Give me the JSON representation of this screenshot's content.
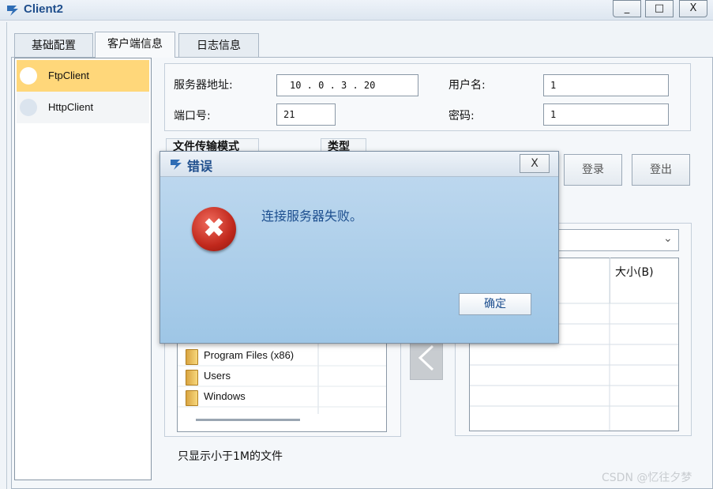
{
  "window": {
    "title": "Client2",
    "controls": {
      "minimize": "_",
      "maximize": "□",
      "close": "X"
    }
  },
  "tabs": [
    {
      "label": "基础配置"
    },
    {
      "label": "客户端信息",
      "active": true
    },
    {
      "label": "日志信息"
    }
  ],
  "client_list": [
    {
      "label": "FtpClient",
      "selected": true
    },
    {
      "label": "HttpClient"
    }
  ],
  "server": {
    "address_label": "服务器地址:",
    "address_value": "10 . 0 . 3 . 20",
    "port_label": "端口号:",
    "port_value": "21",
    "username_label": "用户名:",
    "username_value": "1",
    "password_label": "密码:",
    "password_value": "1"
  },
  "transfer": {
    "mode_label": "文件传输模式",
    "type_label": "类型",
    "login_button": "登录",
    "logout_button": "登出"
  },
  "remote": {
    "size_header": "大小(B)"
  },
  "local_files": [
    {
      "name": "Program Files (x86)"
    },
    {
      "name": "Users"
    },
    {
      "name": "Windows"
    }
  ],
  "filter_note": "只显示小于1M的文件",
  "dialog": {
    "title": "错误",
    "close": "X",
    "message": "连接服务器失败。",
    "ok_button": "确定"
  },
  "watermark": "CSDN @忆往夕梦",
  "colors": {
    "accent": "#1f4e8c",
    "selected_item": "#ffd77a",
    "dialog_body": "#aacfea",
    "error_red": "#c0281c"
  }
}
